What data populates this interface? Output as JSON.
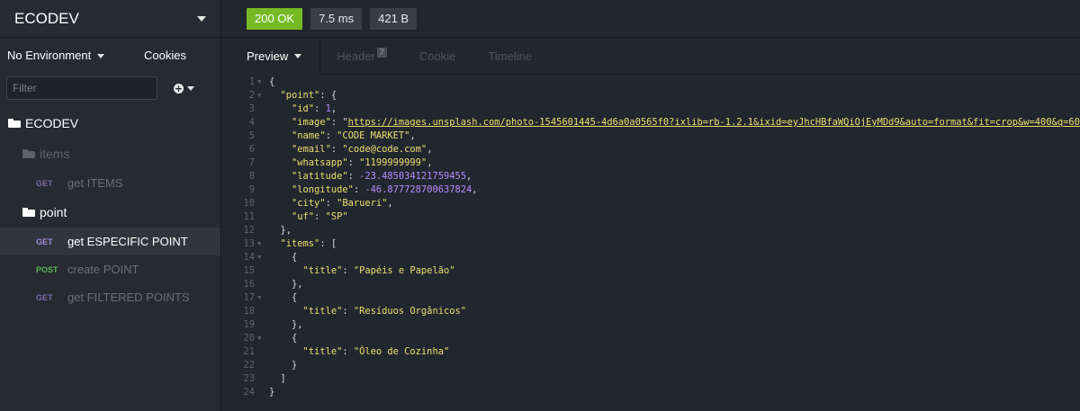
{
  "sidebar": {
    "workspace_title": "ECODEV",
    "environment_label": "No Environment",
    "cookies_label": "Cookies",
    "filter_placeholder": "Filter",
    "tree": {
      "root_folder": "ECODEV",
      "folders": [
        {
          "name": "items",
          "requests": [
            {
              "method": "GET",
              "name": "get ITEMS"
            }
          ]
        },
        {
          "name": "point",
          "requests": [
            {
              "method": "GET",
              "name": "get ESPECIFIC POINT"
            },
            {
              "method": "POST",
              "name": "create POINT"
            },
            {
              "method": "GET",
              "name": "get FILTERED POINTS"
            }
          ]
        }
      ]
    }
  },
  "response": {
    "status": "200 OK",
    "time": "7.5 ms",
    "size": "421 B",
    "tabs": {
      "preview": "Preview",
      "header": "Header",
      "header_count": "7",
      "cookie": "Cookie",
      "timeline": "Timeline"
    },
    "body": {
      "point_key": "\"point\"",
      "id_key": "\"id\"",
      "id_val": "1",
      "image_key": "\"image\"",
      "image_val": "https://images.unsplash.com/photo-1545601445-4d6a0a0565f0?ixlib=rb-1.2.1&ixid=eyJhcHBfaWQiOjEyMDd9&auto=format&fit=crop&w=400&q=60",
      "name_key": "\"name\"",
      "name_val": "\"CODE MARKET\"",
      "email_key": "\"email\"",
      "email_val": "\"code@code.com\"",
      "whatsapp_key": "\"whatsapp\"",
      "whatsapp_val": "\"1199999999\"",
      "latitude_key": "\"latitude\"",
      "latitude_val": "-23.485034121759455",
      "longitude_key": "\"longitude\"",
      "longitude_val": "-46.877728700637824",
      "city_key": "\"city\"",
      "city_val": "\"Barueri\"",
      "uf_key": "\"uf\"",
      "uf_val": "\"SP\"",
      "items_key": "\"items\"",
      "title_key": "\"title\"",
      "item1": "\"Papéis e Papelão\"",
      "item2": "\"Resíduos Orgânicos\"",
      "item3": "\"Óleo de Cozinha\""
    }
  }
}
